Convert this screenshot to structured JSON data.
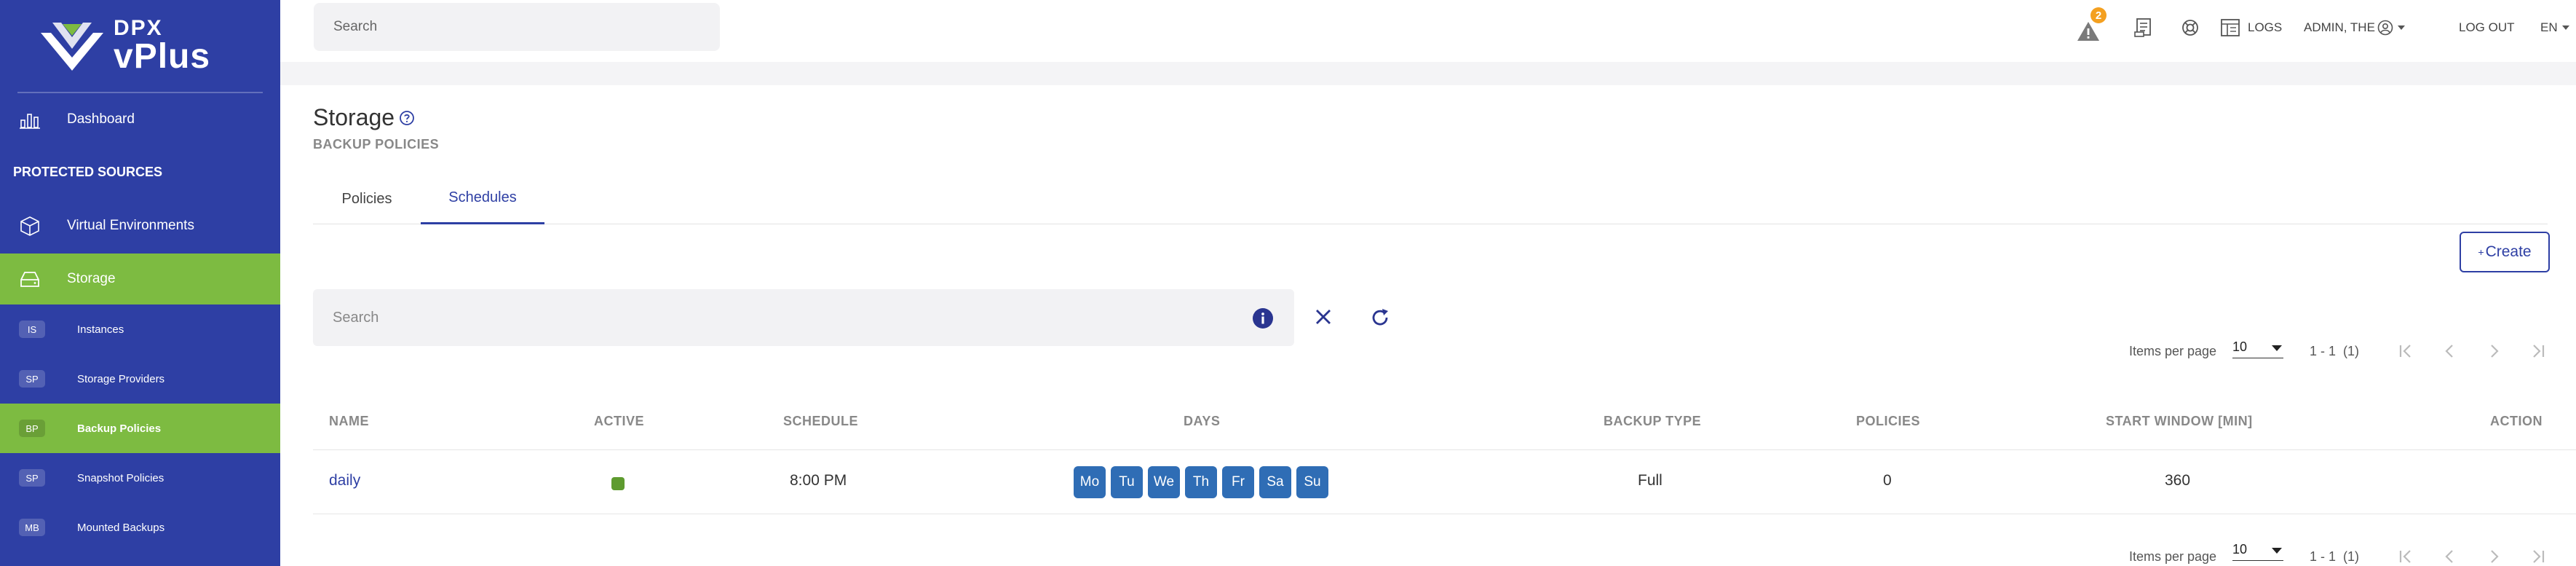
{
  "app": {
    "logo_line1": "DPX",
    "logo_line2": "vPlus"
  },
  "sidebar": {
    "dashboard": "Dashboard",
    "section": "PROTECTED SOURCES",
    "virtual_environments": "Virtual Environments",
    "storage": "Storage",
    "items": [
      {
        "badge": "IS",
        "label": "Instances"
      },
      {
        "badge": "SP",
        "label": "Storage Providers"
      },
      {
        "badge": "BP",
        "label": "Backup Policies"
      },
      {
        "badge": "SP",
        "label": "Snapshot Policies"
      },
      {
        "badge": "MB",
        "label": "Mounted Backups"
      }
    ]
  },
  "header": {
    "search_placeholder": "Search",
    "notification_count": "2",
    "logs": "LOGS",
    "user": "ADMIN, THE",
    "logout": "LOG OUT",
    "language": "EN"
  },
  "page": {
    "title": "Storage",
    "subtitle": "BACKUP POLICIES",
    "tabs": [
      "Policies",
      "Schedules"
    ],
    "active_tab": "Schedules",
    "create_label": "Create",
    "filter_placeholder": "Search"
  },
  "pager": {
    "items_per_page_label": "Items per page",
    "page_size": "10",
    "range": "1 - 1",
    "total": "(1)"
  },
  "table": {
    "headers": [
      "NAME",
      "ACTIVE",
      "SCHEDULE",
      "DAYS",
      "BACKUP TYPE",
      "POLICIES",
      "START WINDOW [MIN]",
      "ACTION"
    ],
    "rows": [
      {
        "name": "daily",
        "active": true,
        "schedule": "8:00 PM",
        "days": [
          "Mo",
          "Tu",
          "We",
          "Th",
          "Fr",
          "Sa",
          "Su"
        ],
        "backup_type": "Full",
        "policies": "0",
        "start_window": "360"
      }
    ]
  },
  "colors": {
    "sidebar_bg": "#2e3fa4",
    "active_green": "#7dbb41",
    "accent": "#2e3fa4",
    "day_chip": "#2f6db5",
    "warning": "#f4a020"
  }
}
